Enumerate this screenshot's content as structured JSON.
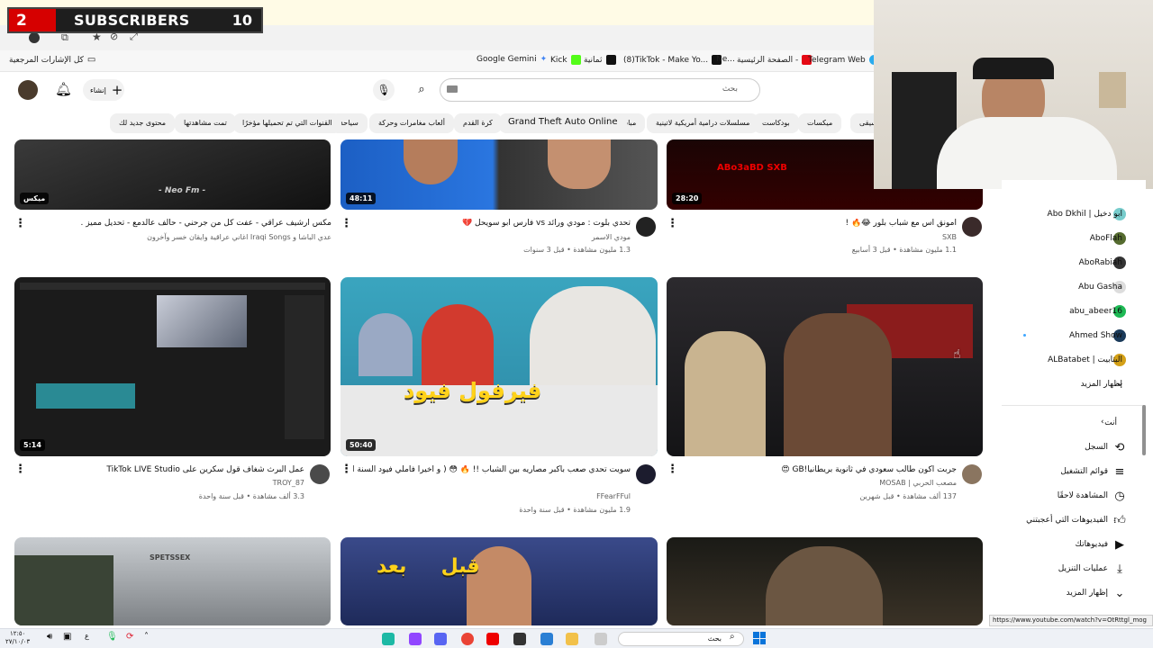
{
  "overlay": {
    "sub_number": "2",
    "sub_label": "SUBSCRIBERS",
    "sub_count": "10"
  },
  "bookmarks": {
    "all_label": "كل الإشارات المرجعية",
    "items": [
      "Google Gemini",
      "Kick",
      "ثمانية",
      "(8)TikTok - Make Yo...",
      "Ne...",
      "الصفحة الرئيسية -",
      "Telegram Web"
    ]
  },
  "header": {
    "search_placeholder": "بحث",
    "create_label": "إنشاء"
  },
  "chips": [
    "موسيقى",
    "ميكسات",
    "بودكاست",
    "مسلسلات درامية أمريكية لاتينية",
    "مباشر",
    "Grand Theft Auto Online",
    "كرة القدم",
    "ألعاب مغامرات وحركة",
    "سياحة",
    "القنوات التي تم تحميلها مؤخرًا",
    "تمت مشاهدتها",
    "محتوى جديد لك"
  ],
  "videos": [
    {
      "title": "مكس ارشيف عراقي - عفت كل من جرحني - حالف عالدمع - تحديل مميز .",
      "channel": "عدي الباشا و Iraqi Songs",
      "meta": "اغاني عراقية وايقان خسر وآخرون",
      "duration": "ميكس",
      "thumb_text": "- Neo Fm -"
    },
    {
      "title": "تحدي بلوت : مودي ورائد vs فارس ابو سويحل 💔",
      "channel": "مودي الاسمر",
      "meta": "1.3 مليون مشاهدة • قبل 3 سنوات",
      "duration": "48:11",
      "thumb_text": ""
    },
    {
      "title": "امونق اس مع شباب بلور 😂🔥 !",
      "channel": "SXB",
      "meta": "1.1 مليون مشاهدة • قبل 3 أسابيع",
      "duration": "28:20",
      "thumb_text": "ABo3aBD  SXB"
    },
    {
      "title": "عمل البرث شغاف قول سكرين على TikTok LIVE Studio",
      "channel": "TROY_87",
      "meta": "3.3 ألف مشاهدة • قبل سنة واحدة",
      "duration": "5:14",
      "thumb_text": ""
    },
    {
      "title": "سويت تحدي صعب بأكبر مصاريه بين الشباب !! 🔥 😳 ( و اخيراً فاملي فيود السنة الثالثة",
      "channel": "FFearFFul",
      "meta": "1.9 مليون مشاهدة • قبل سنة واحدة",
      "duration": "50:40",
      "thumb_text": "فيرفول فيود"
    },
    {
      "title": "جربت اكون طالب سعودي في ثانوية بريطانيا!GB 😍",
      "channel": "مصعب الحربي | MOSAB",
      "meta": "137 ألف مشاهدة • قبل شهرين",
      "duration": "",
      "thumb_text": ""
    },
    {
      "title": "",
      "channel": "",
      "meta": "",
      "duration": "",
      "thumb_text": "SPETSSEX"
    },
    {
      "title": "",
      "channel": "",
      "meta": "",
      "duration": "",
      "thumb_text": "قبل     بعد"
    },
    {
      "title": "",
      "channel": "",
      "meta": "",
      "duration": "",
      "thumb_text": ""
    }
  ],
  "sidebar": {
    "subs": [
      "ابو دخيل | Abo Dkhil",
      "AboFlah",
      "AboRabiah",
      "Abu Gasha",
      "abu_abeer16",
      "Ahmed Show",
      "البتابيت | ALBatabet"
    ],
    "show_more": "إظهار المزيد",
    "you_label": "أنت",
    "you_items": [
      "السجل",
      "قوائم التشغيل",
      "المشاهدة لاحقًا",
      "الفيديوهات التي أعجبتني",
      "فيديوهاتك",
      "عمليات التنزيل"
    ],
    "show_more2": "إظهار المزيد"
  },
  "status_url": "https://www.youtube.com/watch?v=OtRttgl_mog",
  "taskbar": {
    "search": "بحث",
    "time": "١٢:٥٠",
    "date": "٢٧/١٠/٠٣"
  }
}
